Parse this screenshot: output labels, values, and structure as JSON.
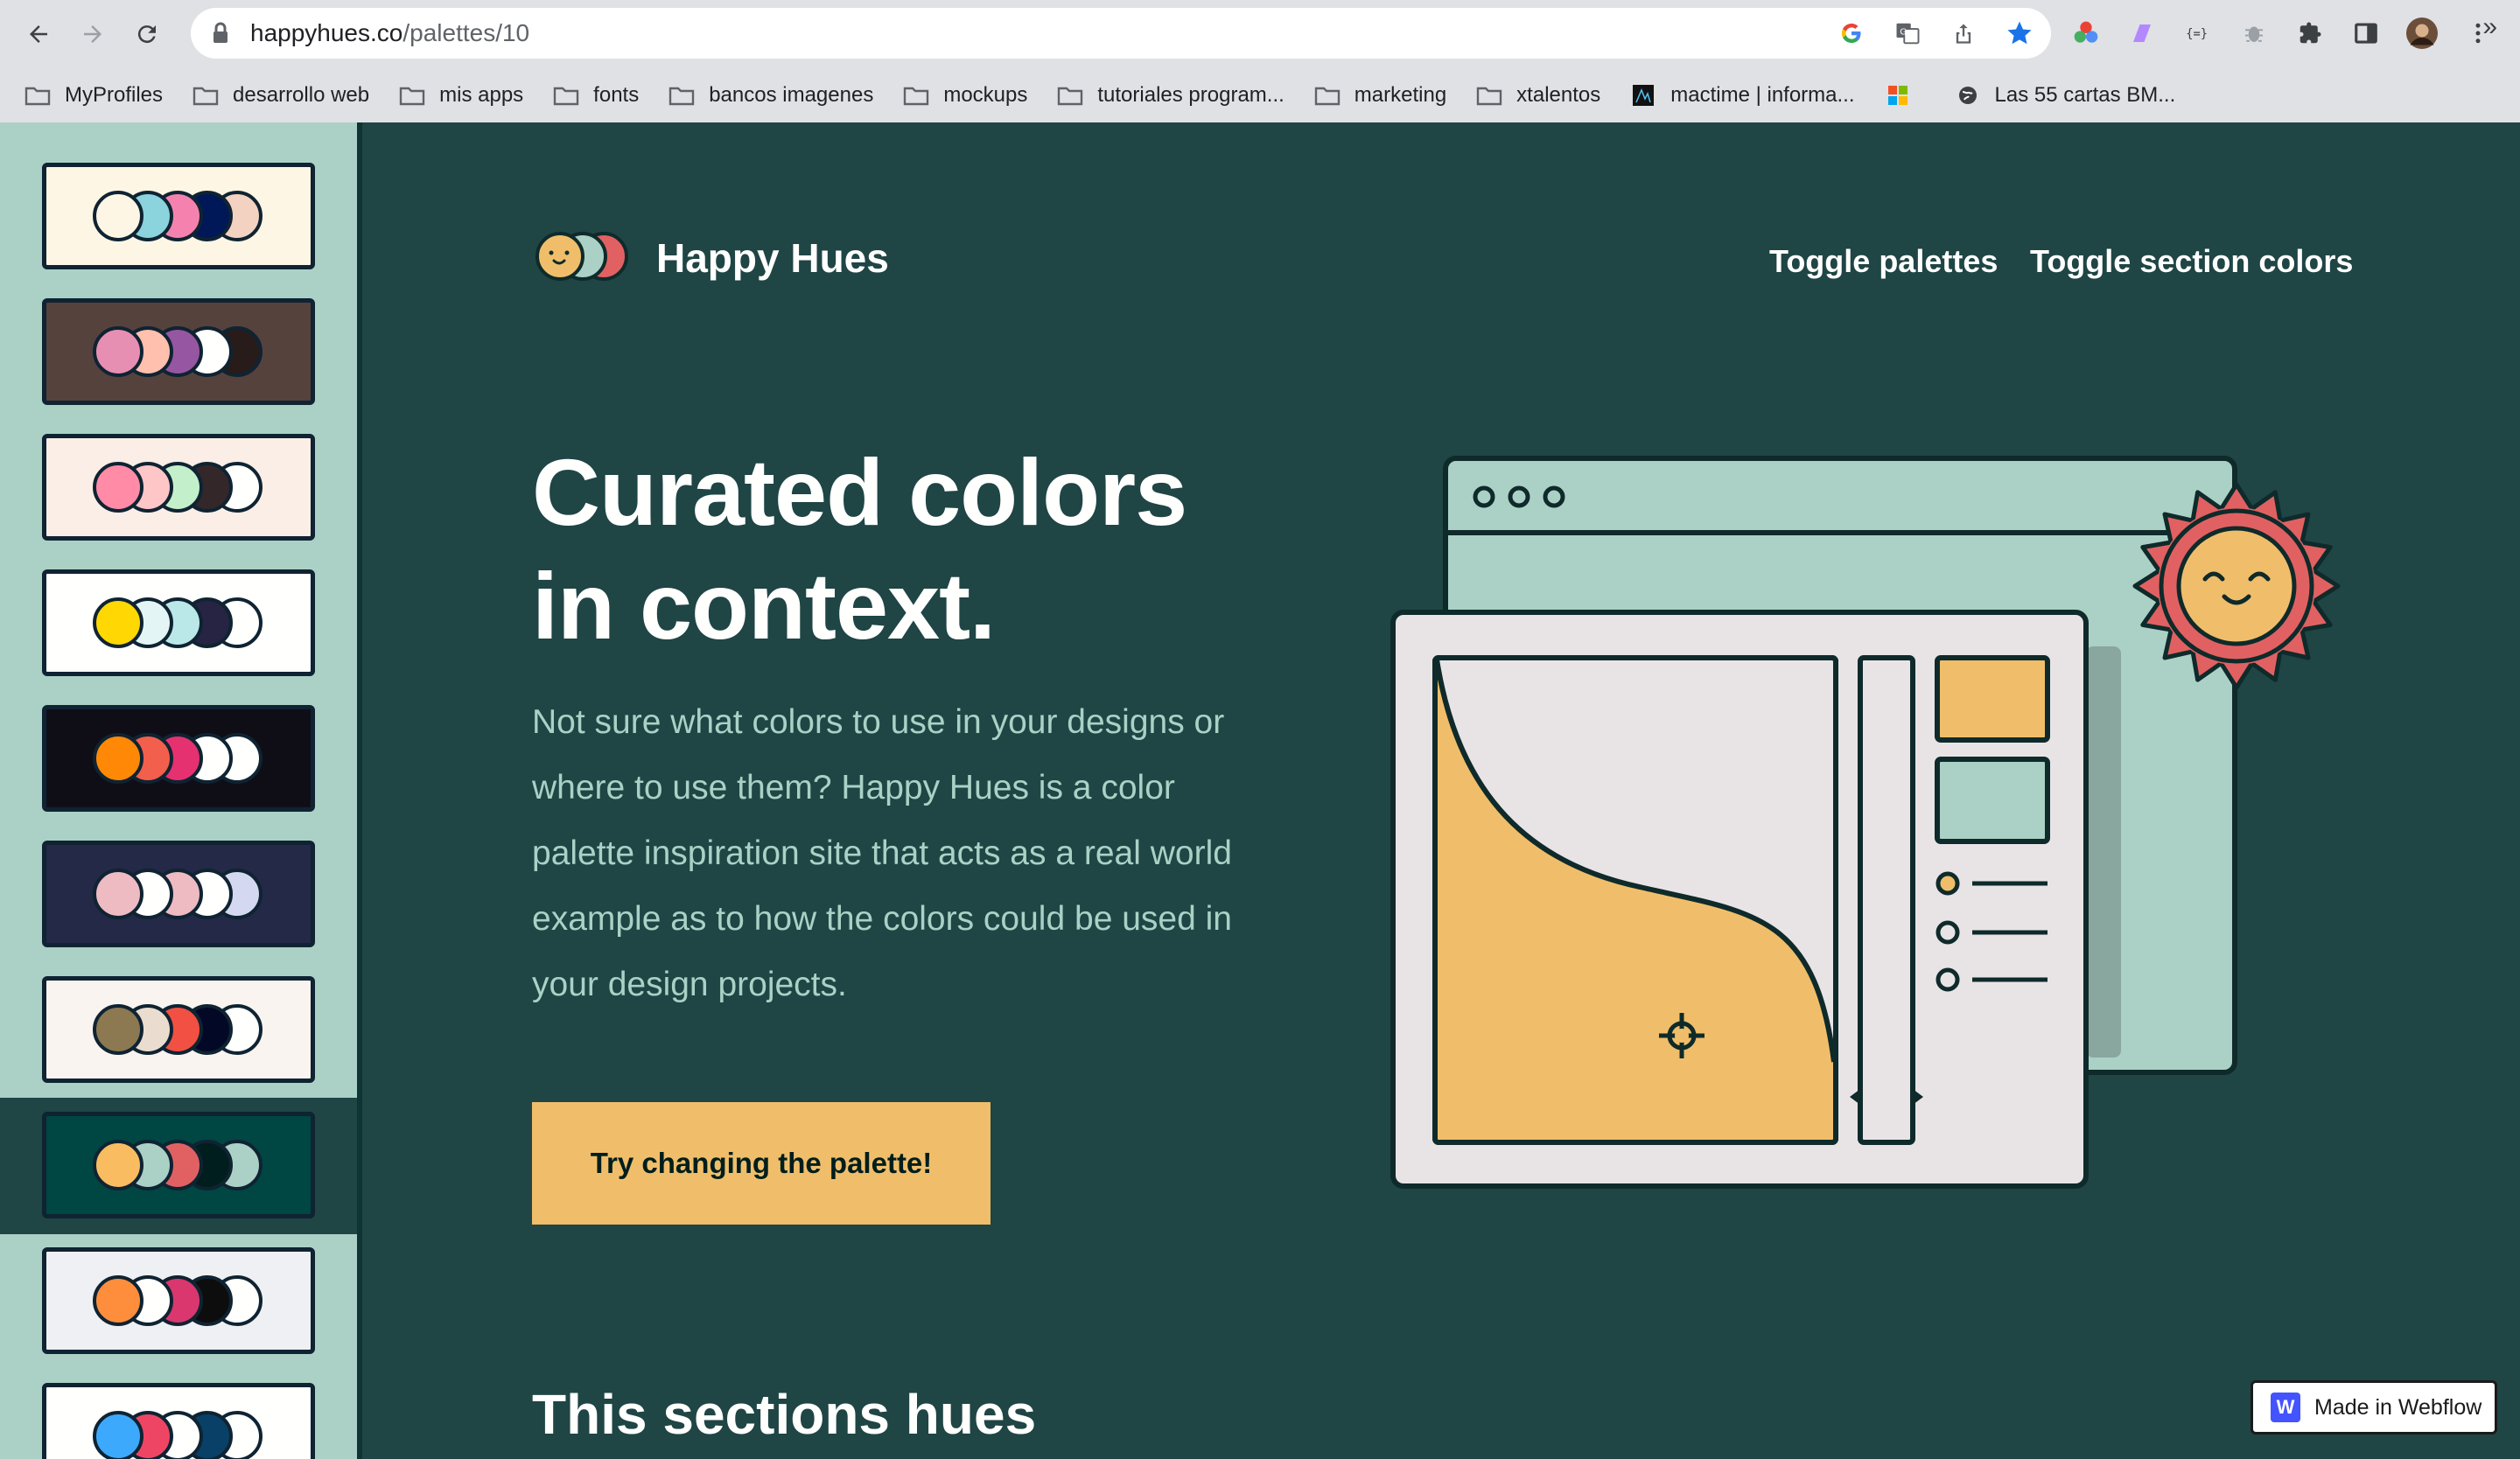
{
  "browser": {
    "url_host": "happyhues.co",
    "url_path": "/palettes/10",
    "bookmarks": [
      {
        "label": "MyProfiles",
        "icon": "folder-icon"
      },
      {
        "label": "desarrollo web",
        "icon": "folder-icon"
      },
      {
        "label": "mis apps",
        "icon": "folder-icon"
      },
      {
        "label": "fonts",
        "icon": "folder-icon"
      },
      {
        "label": "bancos imagenes",
        "icon": "folder-icon"
      },
      {
        "label": "mockups",
        "icon": "folder-icon"
      },
      {
        "label": "tutoriales program...",
        "icon": "folder-icon"
      },
      {
        "label": "marketing",
        "icon": "folder-icon"
      },
      {
        "label": "xtalentos",
        "icon": "folder-icon"
      },
      {
        "label": "mactime | informa...",
        "icon": "mactime-icon"
      },
      {
        "label": "",
        "icon": "microsoft-icon"
      },
      {
        "label": "Las 55 cartas BM...",
        "icon": "globe-icon"
      }
    ],
    "more_label": "»"
  },
  "sidebar": {
    "palettes": [
      {
        "bg": "#fef6e4",
        "colors": [
          "#fef6e4",
          "#8bd3dd",
          "#f582ae",
          "#001858",
          "#f3d2c1"
        ]
      },
      {
        "bg": "#55423d",
        "colors": [
          "#e78fb3",
          "#ffc0ad",
          "#9656a1",
          "#fffffe",
          "#271c19"
        ]
      },
      {
        "bg": "#faeee7",
        "colors": [
          "#ff8ba7",
          "#ffc6c7",
          "#c3f0ca",
          "#33272a",
          "#fffffe"
        ]
      },
      {
        "bg": "#fffffe",
        "colors": [
          "#ffd803",
          "#e3f6f5",
          "#bae8e8",
          "#272343",
          "#fffffe"
        ]
      },
      {
        "bg": "#0f0e17",
        "colors": [
          "#ff8906",
          "#f25f4c",
          "#e53170",
          "#fffffe",
          "#fffffe"
        ]
      },
      {
        "bg": "#232946",
        "colors": [
          "#eebbc3",
          "#fffffe",
          "#eebbc3",
          "#fffffe",
          "#d4d8f0"
        ]
      },
      {
        "bg": "#f9f4ef",
        "colors": [
          "#8c7851",
          "#eaddcf",
          "#f25042",
          "#020826",
          "#fffffe"
        ]
      },
      {
        "bg": "#004643",
        "colors": [
          "#f9bc60",
          "#abd1c6",
          "#e16162",
          "#001e1d",
          "#abd1c6"
        ]
      },
      {
        "bg": "#eff0f3",
        "colors": [
          "#ff8e3c",
          "#fffffe",
          "#d9376e",
          "#0d0d0d",
          "#fffffe"
        ]
      },
      {
        "bg": "#fffffe",
        "colors": [
          "#3da9fc",
          "#ef4565",
          "#fffffe",
          "#094067",
          "#fffffe"
        ]
      }
    ],
    "active_index": 7
  },
  "header": {
    "brand": "Happy Hues",
    "nav": [
      "Toggle palettes",
      "Toggle section colors"
    ]
  },
  "hero": {
    "title_line1": "Curated colors",
    "title_line2": "in context.",
    "description": "Not sure what colors to use in your designs or where to use them? Happy Hues is a color palette inspiration site that acts as a real world example as to how the colors could be used in your design projects.",
    "cta": "Try changing the palette!"
  },
  "section": {
    "title": "This sections hues"
  },
  "badge": {
    "label": "Made in Webflow",
    "logo_letter": "W"
  },
  "colors": {
    "background": "#1f4545",
    "headline": "#fffffe",
    "paragraph": "#abd1c6",
    "button": "#f0be6a",
    "button_text": "#001e1d",
    "sidebar_bg": "#abd1c6",
    "illustration_stroke": "#0f2a2a",
    "illustration_fill": "#e8e4e6",
    "tertiary": "#e16162"
  }
}
